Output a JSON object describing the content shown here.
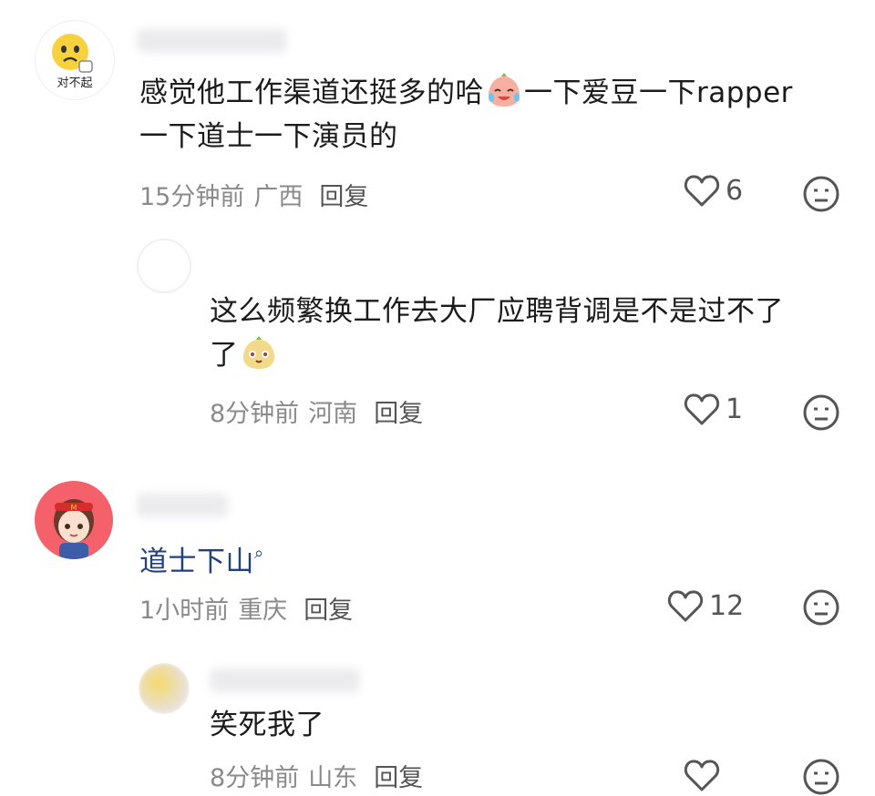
{
  "comments": [
    {
      "avatar_caption": "对不起",
      "text_a": "感觉他工作渠道还挺多的哈",
      "text_b": "一下爱豆一下rapper",
      "text_c": "一下道士一下演员的",
      "time": "15分钟前",
      "location": "广西",
      "reply_label": "回复",
      "likes": "6"
    },
    {
      "text_a": "这么频繁换工作去大厂应聘背调是不是过不了",
      "text_b": "了",
      "time": "8分钟前",
      "location": "河南",
      "reply_label": "回复",
      "likes": "1"
    },
    {
      "text_a": "道士下山",
      "time": "1小时前",
      "location": "重庆",
      "reply_label": "回复",
      "likes": "12"
    },
    {
      "text_a": "笑死我了",
      "time": "8分钟前",
      "location": "山东",
      "reply_label": "回复",
      "likes": ""
    }
  ],
  "colors": {
    "meta": "#8a8a8a",
    "link": "#21407f",
    "avatar_bg_red": "#f4616b"
  },
  "icons": [
    "heart-outline-icon",
    "dislike-face-icon",
    "search-icon"
  ]
}
